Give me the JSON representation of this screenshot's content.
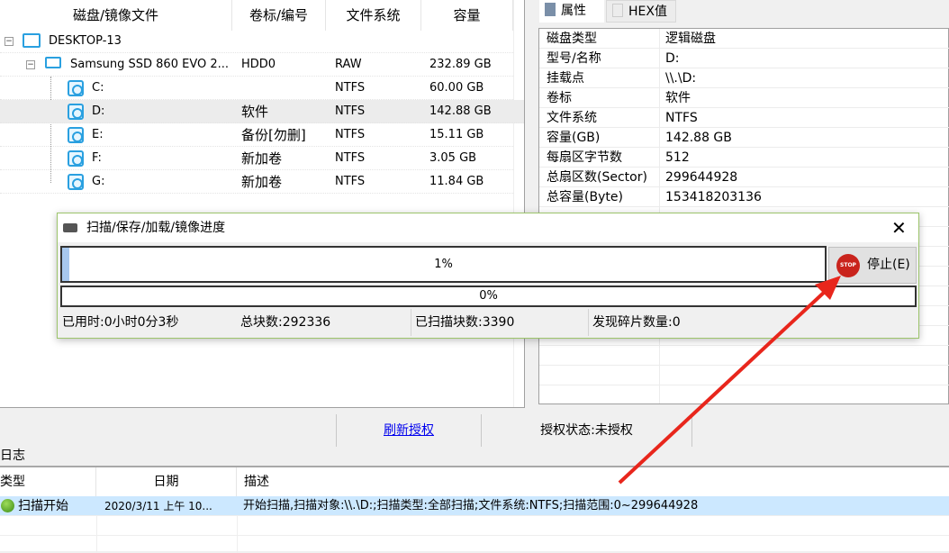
{
  "tree": {
    "headers": [
      "磁盘/镜像文件",
      "卷标/编号",
      "文件系统",
      "容量"
    ],
    "computer": "DESKTOP-13",
    "disk": {
      "name": "Samsung SSD 860 EVO 2...",
      "vol": "HDD0",
      "fs": "RAW",
      "cap": "232.89 GB"
    },
    "partitions": [
      {
        "name": "C:",
        "vol": "",
        "fs": "NTFS",
        "cap": "60.00 GB"
      },
      {
        "name": "D:",
        "vol": "软件",
        "fs": "NTFS",
        "cap": "142.88 GB"
      },
      {
        "name": "E:",
        "vol": "备份[勿删]",
        "fs": "NTFS",
        "cap": "15.11 GB"
      },
      {
        "name": "F:",
        "vol": "新加卷",
        "fs": "NTFS",
        "cap": "3.05 GB"
      },
      {
        "name": "G:",
        "vol": "新加卷",
        "fs": "NTFS",
        "cap": "11.84 GB"
      }
    ]
  },
  "right": {
    "tabs": [
      "属性",
      "HEX值"
    ],
    "props": [
      {
        "k": "磁盘类型",
        "v": "逻辑磁盘"
      },
      {
        "k": "型号/名称",
        "v": "D:"
      },
      {
        "k": "挂载点",
        "v": "\\\\.\\D:"
      },
      {
        "k": "卷标",
        "v": "软件"
      },
      {
        "k": "文件系统",
        "v": "NTFS"
      },
      {
        "k": "容量(GB)",
        "v": "142.88 GB"
      },
      {
        "k": "每扇区字节数",
        "v": "512"
      },
      {
        "k": "总扇区数(Sector)",
        "v": "299644928"
      },
      {
        "k": "总容量(Byte)",
        "v": "153418203136"
      }
    ]
  },
  "status": {
    "refresh": "刷新授权",
    "auth": "授权状态:未授权"
  },
  "log": {
    "label": "日志",
    "headers": [
      "类型",
      "日期",
      "描述"
    ],
    "rows": [
      {
        "type": "扫描开始",
        "date": "2020/3/11 上午 10...",
        "desc": "开始扫描,扫描对象:\\\\.\\D:;扫描类型:全部扫描;文件系统:NTFS;扫描范围:0~299644928"
      }
    ]
  },
  "dialog": {
    "title": "扫描/保存/加载/镜像进度",
    "progress1": "1%",
    "progress1_value": 1,
    "progress2": "0%",
    "progress2_value": 0,
    "stop": "停止(E)",
    "elapsed": "已用时:0小时0分3秒",
    "total": "总块数:292336",
    "scanned": "已扫描块数:3390",
    "fragments": "发现碎片数量:0"
  },
  "colors": {
    "selection": "#cce8ff",
    "accent": "#2aa0e0",
    "arrow": "#e8261c"
  }
}
